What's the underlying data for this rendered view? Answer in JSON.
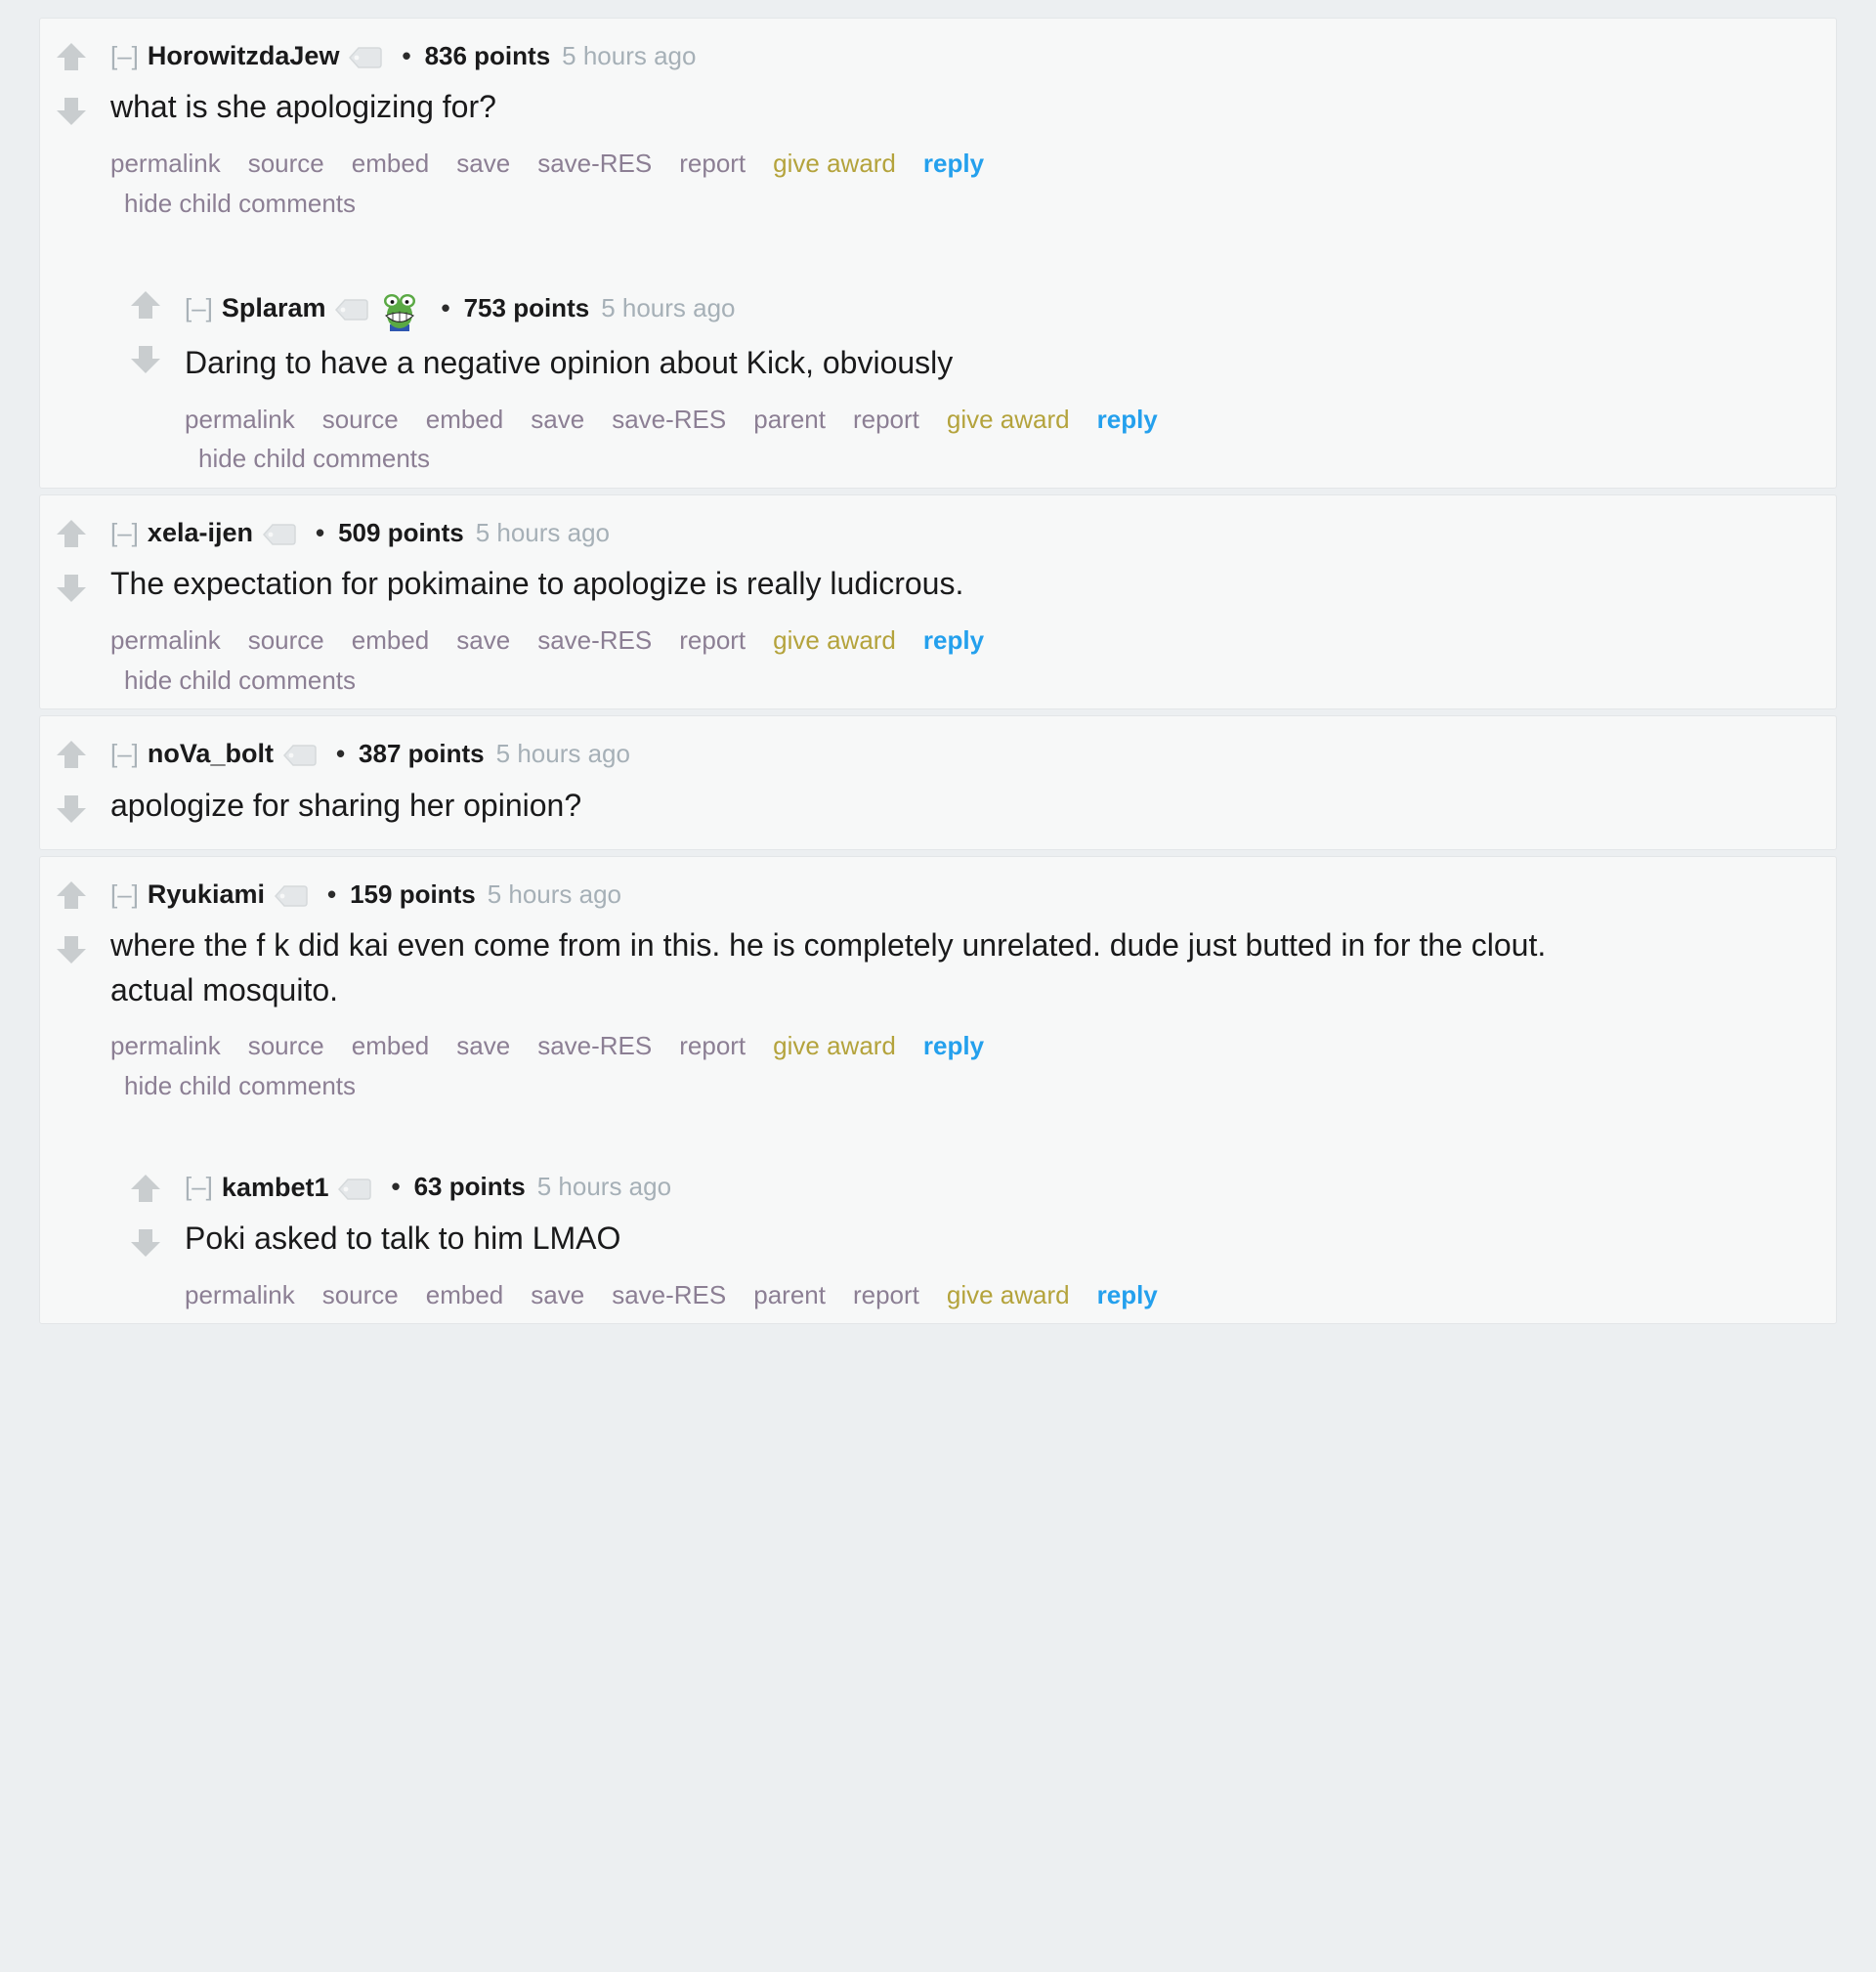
{
  "ui": {
    "collapse_toggle": "[–]",
    "separator_dot": "•",
    "points_suffix": "points",
    "hide_child_comments": "hide child comments",
    "icons": {
      "upvote": "upvote-arrow-icon",
      "downvote": "downvote-arrow-icon",
      "user_tag": "user-tag-icon",
      "flair_emoji": "pepe-frog-emoji-icon"
    },
    "colors": {
      "page_background": "#eceff1",
      "card_background": "#f7f8f8",
      "card_border": "#e3e6e8",
      "author": "#1a1a1b",
      "body_text": "#1a1a1b",
      "timestamp": "#a6b0b7",
      "action_link": "#8c7f94",
      "give_award": "#b4a33c",
      "reply": "#24a0ed",
      "vote_arrow": "#c9cdcf"
    }
  },
  "actions": {
    "permalink": "permalink",
    "source": "source",
    "embed": "embed",
    "save": "save",
    "save_res": "save-RES",
    "parent": "parent",
    "report": "report",
    "give_award": "give award",
    "reply": "reply"
  },
  "comments": [
    {
      "id": "horowitzdajew",
      "author": "HorowitzdaJew",
      "points": "836",
      "points_label": "836 points",
      "age": "5 hours ago",
      "has_tag_icon": true,
      "has_flair_emoji": false,
      "has_parent_link": false,
      "depth": 0,
      "body": [
        "what is she apologizing for?"
      ]
    },
    {
      "id": "splaram",
      "author": "Splaram",
      "points": "753",
      "points_label": "753 points",
      "age": "5 hours ago",
      "has_tag_icon": true,
      "has_flair_emoji": true,
      "has_parent_link": true,
      "depth": 1,
      "body": [
        "Daring to have a negative opinion about Kick, obviously"
      ]
    },
    {
      "id": "xela-ijen",
      "author": "xela-ijen",
      "points": "509",
      "points_label": "509 points",
      "age": "5 hours ago",
      "has_tag_icon": true,
      "has_flair_emoji": false,
      "has_parent_link": false,
      "depth": 0,
      "body": [
        "The expectation for pokimaine to apologize is really ludicrous."
      ]
    },
    {
      "id": "nova_bolt",
      "author": "noVa_bolt",
      "points": "387",
      "points_label": "387 points",
      "age": "5 hours ago",
      "has_tag_icon": true,
      "has_flair_emoji": false,
      "has_parent_link": false,
      "depth": 0,
      "body": [
        "apologize for sharing her opinion?"
      ]
    },
    {
      "id": "ryukiami",
      "author": "Ryukiami",
      "points": "159",
      "points_label": "159 points",
      "age": "5 hours ago",
      "has_tag_icon": true,
      "has_flair_emoji": false,
      "has_parent_link": false,
      "depth": 0,
      "body": [
        "where the f   k did kai even come from in this. he is completely unrelated. dude just butted in for the clout. actual mosquito."
      ]
    },
    {
      "id": "kambet1",
      "author": "kambet1",
      "points": "63",
      "points_label": "63 points",
      "age": "5 hours ago",
      "has_tag_icon": true,
      "has_flair_emoji": false,
      "has_parent_link": true,
      "depth": 1,
      "body": [
        "Poki asked to talk to him LMAO"
      ]
    }
  ]
}
